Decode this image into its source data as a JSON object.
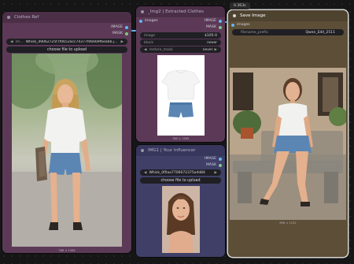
{
  "nodes": {
    "clothes_ref": {
      "title": "Clothes Ref",
      "outputs": [
        "IMAGE",
        "MASK"
      ],
      "file_value": "Whisk_49062725f7f0652acc74377f06669f6ea6b.jpeg",
      "file_prefix": "im…",
      "upload_label": "choose file to upload",
      "image_caption": "768 × 1365",
      "colors": {
        "body": "#5c3a57",
        "title": "#4b2f47",
        "image_bg": "#8b9a77"
      }
    },
    "extracted_clothes": {
      "title": "_Img2 | Extracted Clothes",
      "input": "images",
      "outputs": [
        "IMAGE",
        "MASK"
      ],
      "widgets": [
        {
          "label": "image",
          "value": "$105-0"
        },
        {
          "label": "block",
          "value": "never"
        },
        {
          "label": "restore_mask",
          "value": "never"
        }
      ],
      "image_caption": "768 × 1365",
      "colors": {
        "body": "#5c3a57",
        "title": "#4b2f47"
      }
    },
    "influencer": {
      "title": "IMG1 | Your Influencer",
      "outputs": [
        "IMAGE",
        "MASK"
      ],
      "file_value": "Whisk_0f0aa7706072375a4d84",
      "upload_label": "choose file to upload",
      "image_caption": "768 × 1365",
      "colors": {
        "body": "#3f3f68",
        "title": "#37365c"
      }
    },
    "save_image": {
      "title": "Save Image",
      "badge": "0.363s",
      "input": "images",
      "widgets": [
        {
          "label": "filename_prefix",
          "value": "Qwen_Edit_2511"
        }
      ],
      "image_caption": "896 × 1152",
      "colors": {
        "body": "#5d4e37",
        "title": "#4e432f",
        "border": "#d8d8d8"
      }
    }
  },
  "link_colors": {
    "image": "#64b5f6",
    "mask": "#81c784"
  }
}
